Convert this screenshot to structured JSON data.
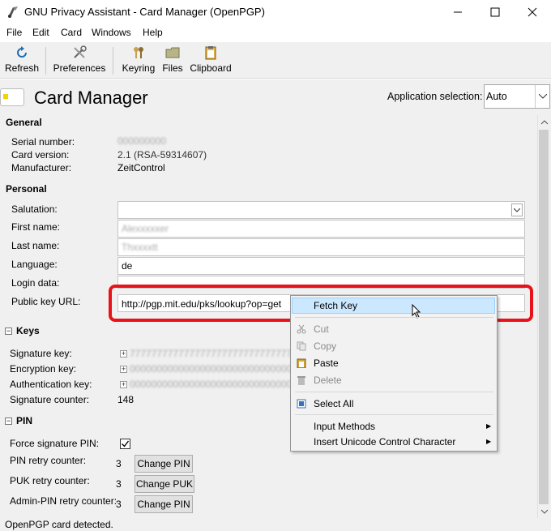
{
  "window": {
    "title": "GNU Privacy Assistant - Card Manager (OpenPGP)"
  },
  "menu": {
    "file": "File",
    "edit": "Edit",
    "card": "Card",
    "windows": "Windows",
    "help": "Help"
  },
  "toolbar": {
    "refresh": "Refresh",
    "preferences": "Preferences",
    "keyring": "Keyring",
    "files": "Files",
    "clipboard": "Clipboard"
  },
  "header": {
    "title": "Card Manager",
    "app_selection_label": "Application selection:",
    "app_selection_value": "Auto"
  },
  "general": {
    "title": "General",
    "serial_label": "Serial number:",
    "serial_value": "000000000",
    "card_version_label": "Card version:",
    "card_version_value": "2.1 (RSA-59314607)",
    "manufacturer_label": "Manufacturer:",
    "manufacturer_value": "ZeitControl"
  },
  "personal": {
    "title": "Personal",
    "salutation_label": "Salutation:",
    "salutation_value": "",
    "first_name_label": "First name:",
    "first_name_value": "Alexxxxxer",
    "last_name_label": "Last name:",
    "last_name_value": "Thxxxxtt",
    "language_label": "Language:",
    "language_value": "de",
    "login_label": "Login data:",
    "login_value": "",
    "url_label": "Public key URL:",
    "url_value": "http://pgp.mit.edu/pks/lookup?op=get"
  },
  "keys": {
    "title": "Keys",
    "signature_label": "Signature key:",
    "signature_value": "7777777777777777777777777777777777777777",
    "encryption_label": "Encryption key:",
    "encryption_value": "0000000000000000000000000000000000000000",
    "authentication_label": "Authentication key:",
    "authentication_value": "0000000000000000000000000000000000000000",
    "counter_label": "Signature counter:",
    "counter_value": "148"
  },
  "pin": {
    "title": "PIN",
    "force_label": "Force signature PIN:",
    "force_checked": true,
    "pin_retry_label": "PIN retry counter:",
    "pin_retry_value": "3",
    "change_pin": "Change PIN",
    "puk_retry_label": "PUK retry counter:",
    "puk_retry_value": "3",
    "change_puk": "Change PUK",
    "admin_retry_label": "Admin-PIN retry counter:",
    "admin_retry_value": "3",
    "change_admin_pin": "Change PIN"
  },
  "status": "OpenPGP card detected.",
  "context_menu": {
    "fetch_key": "Fetch Key",
    "cut": "Cut",
    "copy": "Copy",
    "paste": "Paste",
    "delete": "Delete",
    "select_all": "Select All",
    "input_methods": "Input Methods",
    "insert_unicode": "Insert Unicode Control Character"
  },
  "colors": {
    "highlight": "#e8121b",
    "hover": "#cce8ff"
  }
}
